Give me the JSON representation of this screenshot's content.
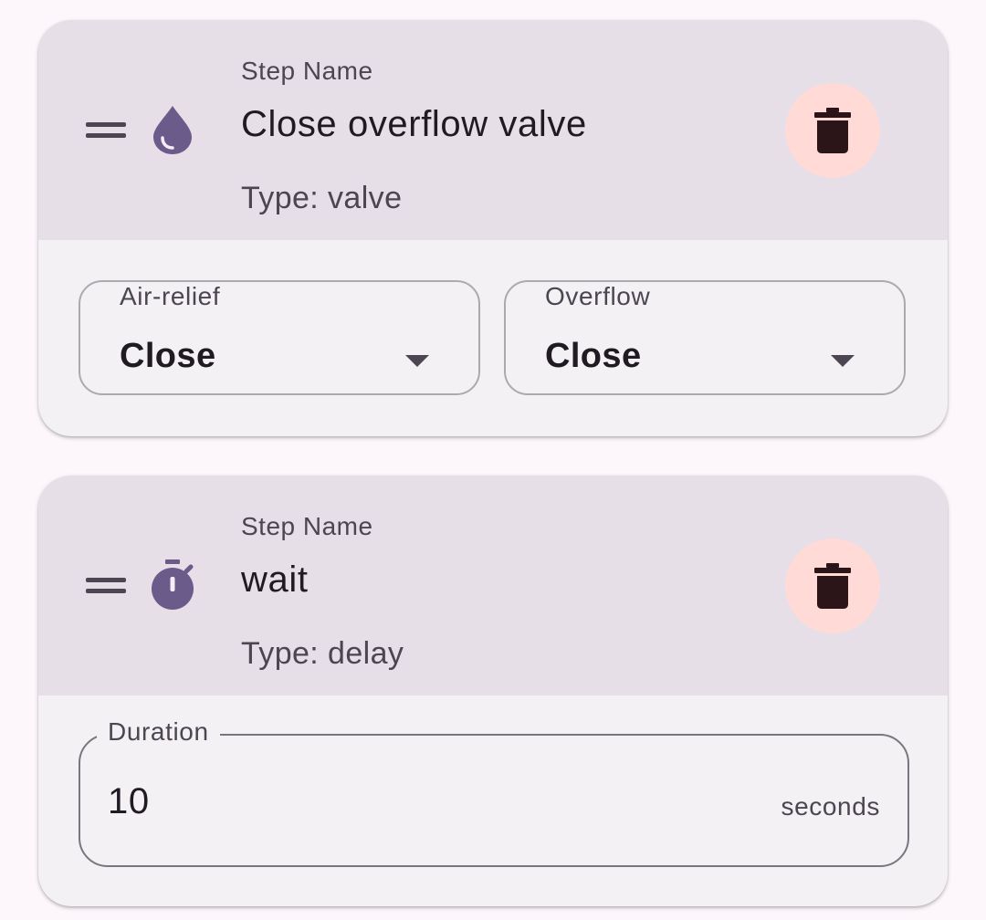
{
  "colors": {
    "page_background": "#fdf7fc",
    "card_background": "#f3f1f4",
    "header_background": "#e7dfe7",
    "icon_accent": "#6b5b8a",
    "delete_button_background": "#ffdad6",
    "delete_icon": "#2c1518"
  },
  "steps": [
    {
      "label": "Step Name",
      "name": "Close overflow valve",
      "type": "Type: valve",
      "icon": "water-drop-icon",
      "fields": [
        {
          "label": "Air-relief",
          "value": "Close"
        },
        {
          "label": "Overflow",
          "value": "Close"
        }
      ]
    },
    {
      "label": "Step Name",
      "name": "wait",
      "type": "Type: delay",
      "icon": "timer-icon",
      "duration": {
        "label": "Duration",
        "value": "10",
        "suffix": "seconds"
      }
    }
  ]
}
